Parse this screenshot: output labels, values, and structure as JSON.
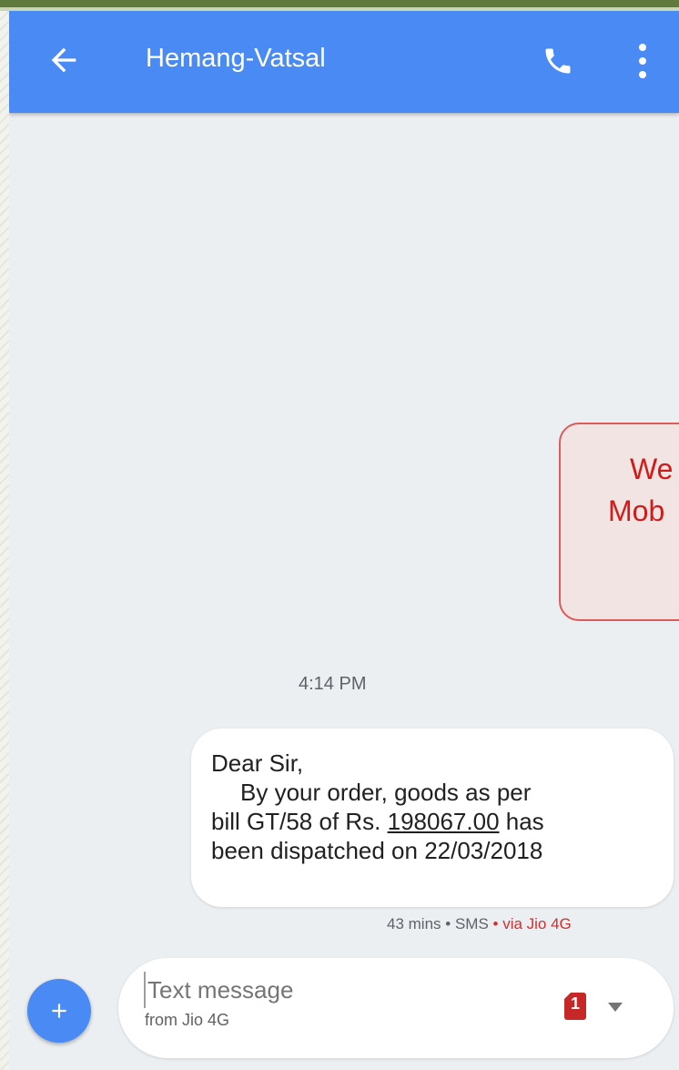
{
  "header": {
    "contact_name": "Hemang-Vatsal"
  },
  "callout": {
    "line1": "We",
    "line2": "Mob"
  },
  "conversation": {
    "timestamp": "4:14 PM",
    "message": {
      "line1": "Dear Sir,",
      "line2": "By your order, goods as per",
      "line3_prefix": "bill GT/58 of Rs. ",
      "line3_amount": "198067.00",
      "line3_suffix": " has",
      "line4": "been dispatched on 22/03/2018"
    },
    "meta": {
      "age": "43 mins",
      "sep1": " • ",
      "type": "SMS",
      "sep2": " • ",
      "via": "via Jio 4G"
    }
  },
  "composer": {
    "placeholder": "Text message",
    "sim_label": "from Jio 4G",
    "sim_number": "1"
  },
  "icons": {
    "back": "arrow-left",
    "call": "phone",
    "menu": "more-vertical",
    "add": "plus",
    "sim": "sim-card",
    "dropdown": "triangle-down"
  },
  "colors": {
    "app_bar": "#4a8af4",
    "background": "#eceff2",
    "callout_text": "#d11a1a",
    "via_text": "#d32f2f"
  }
}
